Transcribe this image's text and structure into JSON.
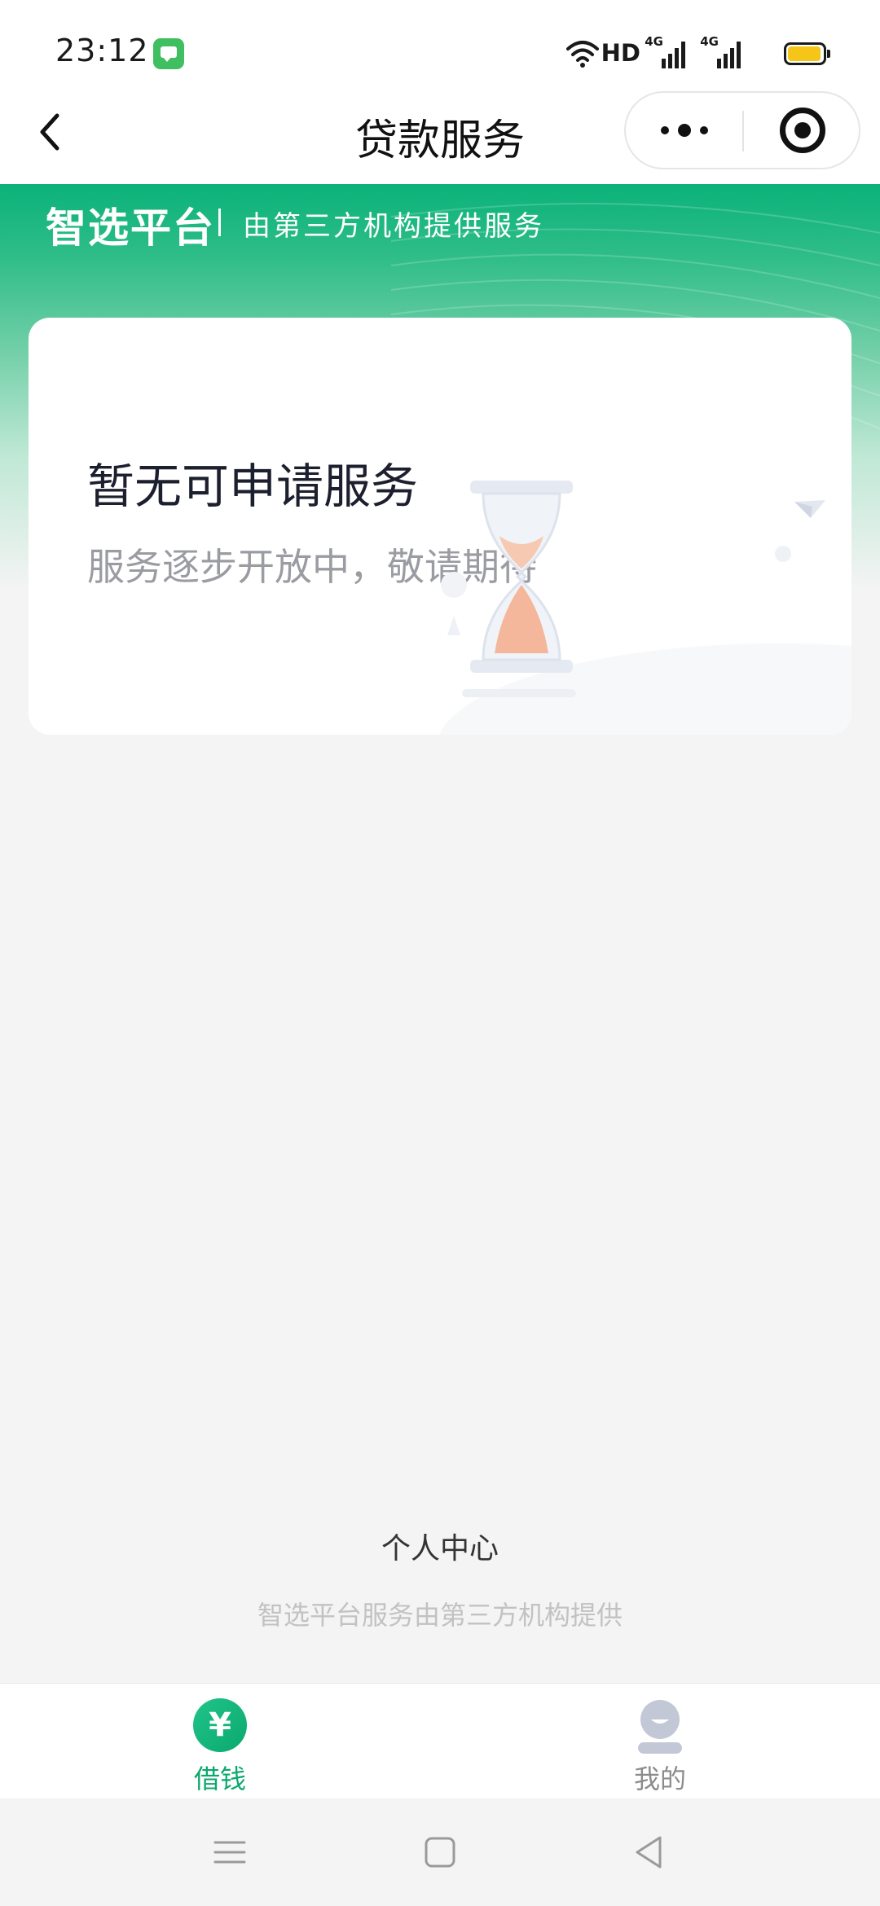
{
  "status_bar": {
    "time": "23:12",
    "network_label": "HD",
    "signal_1": "4G",
    "signal_2": "4G",
    "battery_color": "#f5c518"
  },
  "nav": {
    "title": "贷款服务",
    "back_icon": "chevron-left-icon",
    "more_icon": "more-dots-icon",
    "close_icon": "target-icon"
  },
  "banner": {
    "brand": "智选平台",
    "subtitle": "由第三方机构提供服务",
    "accent_color": "#0bb27a"
  },
  "empty_card": {
    "title": "暂无可申请服务",
    "subtitle": "服务逐步开放中，敬请期待",
    "illustration": "hourglass-icon"
  },
  "footer": {
    "personal_center": "个人中心",
    "note": "智选平台服务由第三方机构提供"
  },
  "tab_bar": {
    "tabs": [
      {
        "label": "借钱",
        "icon": "yuan-icon",
        "active": true,
        "icon_text": "¥"
      },
      {
        "label": "我的",
        "icon": "user-icon",
        "active": false
      }
    ]
  },
  "system_nav": {
    "buttons": [
      "menu-icon",
      "home-icon",
      "back-triangle-icon"
    ]
  }
}
